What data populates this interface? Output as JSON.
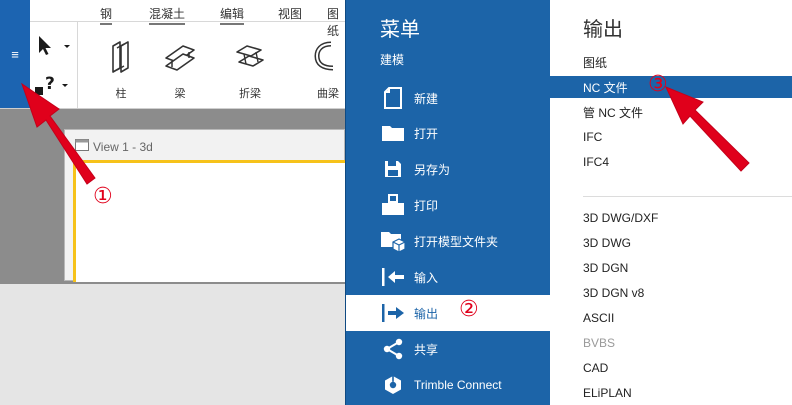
{
  "ribbon": {
    "tabs": [
      "钢",
      "混凝土",
      "编辑",
      "视图",
      "图纸"
    ],
    "buttons": [
      "柱",
      "梁",
      "折梁",
      "曲梁"
    ],
    "menu_icon": "hamburger-icon"
  },
  "view": {
    "title": "View 1 - 3d"
  },
  "markers": {
    "one": "①",
    "two": "②",
    "three": "③"
  },
  "menu": {
    "title": "菜单",
    "section": "建模",
    "items": [
      {
        "label": "新建",
        "icon": "new-file-icon"
      },
      {
        "label": "打开",
        "icon": "folder-icon"
      },
      {
        "label": "另存为",
        "icon": "save-icon"
      },
      {
        "label": "打印",
        "icon": "printer-icon"
      },
      {
        "label": "打开模型文件夹",
        "icon": "model-folder-icon"
      },
      {
        "label": "输入",
        "icon": "import-icon"
      },
      {
        "label": "输出",
        "icon": "export-icon"
      },
      {
        "label": "共享",
        "icon": "share-icon"
      },
      {
        "label": "Trimble Connect",
        "icon": "trimble-connect-icon"
      }
    ]
  },
  "submenu": {
    "title": "输出",
    "group1": [
      "图纸",
      "NC 文件",
      "管 NC 文件",
      "IFC",
      "IFC4"
    ],
    "group2": [
      "3D DWG/DXF",
      "3D DWG",
      "3D DGN",
      "3D DGN v8",
      "ASCII",
      "BVBS",
      "CAD",
      "ELiPLAN"
    ]
  },
  "colors": {
    "menu_blue": "#1c64a8",
    "annotation_red": "#e0001b",
    "view_yellow": "#f6c21a"
  }
}
